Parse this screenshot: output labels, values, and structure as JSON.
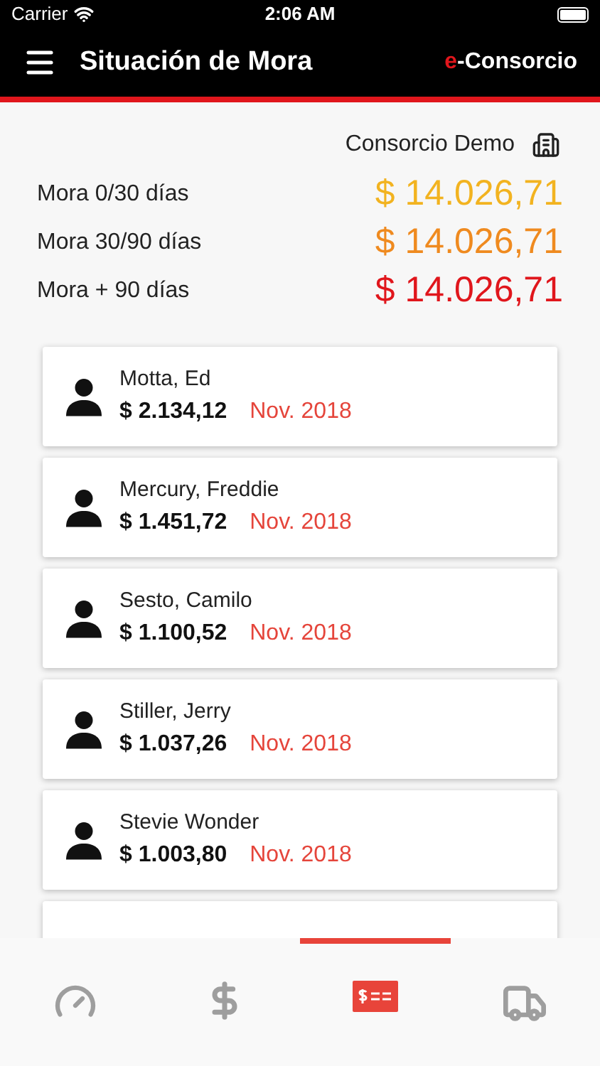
{
  "status_bar": {
    "carrier": "Carrier",
    "time": "2:06 AM"
  },
  "nav_bar": {
    "title": "Situación de Mora",
    "brand_mark": "e",
    "brand": "-Consorcio"
  },
  "company": "Consorcio Demo",
  "mora": [
    {
      "label": "Mora 0/30 días",
      "amount": "$ 14.026,71",
      "color": "#f2b320"
    },
    {
      "label": "Mora 30/90 días",
      "amount": "$ 14.026,71",
      "color": "#ef8a1f"
    },
    {
      "label": "Mora + 90 días",
      "amount": "$ 14.026,71",
      "color": "#e0161c"
    }
  ],
  "debtors": [
    {
      "name": "Motta, Ed",
      "amount": "$ 2.134,12",
      "period": "Nov. 2018"
    },
    {
      "name": "Mercury, Freddie",
      "amount": "$ 1.451,72",
      "period": "Nov. 2018"
    },
    {
      "name": "Sesto, Camilo",
      "amount": "$ 1.100,52",
      "period": "Nov. 2018"
    },
    {
      "name": "Stiller, Jerry",
      "amount": "$ 1.037,26",
      "period": "Nov. 2018"
    },
    {
      "name": "Stevie Wonder",
      "amount": "$ 1.003,80",
      "period": "Nov. 2018"
    },
    {
      "kind": "partial"
    }
  ],
  "tab_bar": [
    {
      "kind": "gauge",
      "selected": false
    },
    {
      "kind": "dollar",
      "selected": false
    },
    {
      "kind": "bill",
      "selected": true
    },
    {
      "kind": "truck",
      "selected": false
    }
  ]
}
